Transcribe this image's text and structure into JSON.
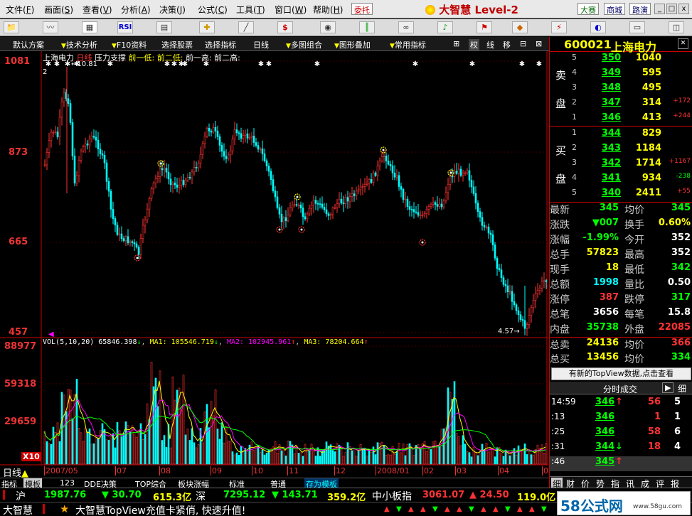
{
  "menu": {
    "items": [
      "文件",
      "画面",
      "查看",
      "分析",
      "决策",
      "公式",
      "工具",
      "窗口",
      "帮助"
    ],
    "entrust": "委托",
    "brand": "大智慧 Level-2",
    "btn_contest": "大赛",
    "btn_mall": "商城",
    "btn_roadshow": "路演",
    "win_min": "_",
    "win_max": "□",
    "win_close": "x"
  },
  "funcbar": {
    "items": [
      "默认方案",
      "技术分析",
      "F10资料",
      "选择股票",
      "选择指标",
      "日线",
      "多图组合",
      "图形叠加",
      "常用指标"
    ],
    "right_items": [
      "⊞",
      "权",
      "线",
      "移",
      "⊟",
      "⊠"
    ]
  },
  "chart": {
    "stock_label": "上海电力",
    "period_label": "日线",
    "indicator_label": "压力支撑",
    "support_labels": [
      "前一低:",
      "前二低:",
      "前一高:",
      "前二高:"
    ],
    "y_ticks": [
      "1081",
      "873",
      "665",
      "457"
    ],
    "high_marker": "10.81",
    "low_marker": "4.57",
    "label_2": "2",
    "vol_label": "VOL(5,10,20)",
    "vol_value": "65846.398",
    "ma1_label": "MA1: 105546.719",
    "ma2_label": "MA2: 102945.961",
    "ma3_label": "MA3: 78204.664",
    "vol_ticks": [
      "88977",
      "59318",
      "29659",
      "X10"
    ],
    "x_labels": [
      "2007/05",
      "07",
      "08",
      "09",
      "10",
      "11",
      "12",
      "2008/01",
      "02",
      "03",
      "04",
      "05"
    ],
    "period_tag": "日线"
  },
  "tabs": [
    "指标",
    "模板",
    "123",
    "DDE决策",
    "TOP综合",
    "板块涨幅",
    "标准",
    "普通",
    "存为模板"
  ],
  "right_panel": {
    "code": "600021",
    "name": "上海电力",
    "sell_label": [
      "卖",
      "盘"
    ],
    "buy_label": [
      "买",
      "盘"
    ],
    "sells": [
      {
        "lv": "5",
        "p": "350",
        "v": "1040",
        "d": ""
      },
      {
        "lv": "4",
        "p": "349",
        "v": "595",
        "d": ""
      },
      {
        "lv": "3",
        "p": "348",
        "v": "495",
        "d": ""
      },
      {
        "lv": "2",
        "p": "347",
        "v": "314",
        "d": "+172"
      },
      {
        "lv": "1",
        "p": "346",
        "v": "413",
        "d": "+244"
      }
    ],
    "buys": [
      {
        "lv": "1",
        "p": "344",
        "v": "829",
        "d": ""
      },
      {
        "lv": "2",
        "p": "343",
        "v": "1184",
        "d": ""
      },
      {
        "lv": "3",
        "p": "342",
        "v": "1714",
        "d": "+1167"
      },
      {
        "lv": "4",
        "p": "341",
        "v": "934",
        "d": "-238"
      },
      {
        "lv": "5",
        "p": "340",
        "v": "2411",
        "d": "+55"
      }
    ],
    "stats": [
      {
        "l1": "最新",
        "v1": "345",
        "c1": "green",
        "l2": "均价",
        "v2": "345",
        "c2": "green"
      },
      {
        "l1": "涨跌",
        "v1": "▼007",
        "c1": "green",
        "l2": "换手",
        "v2": "0.60%",
        "c2": "yellow"
      },
      {
        "l1": "涨幅",
        "v1": "-1.99%",
        "c1": "green",
        "l2": "今开",
        "v2": "352",
        "c2": "white"
      },
      {
        "l1": "总手",
        "v1": "57823",
        "c1": "yellow",
        "l2": "最高",
        "v2": "352",
        "c2": "white"
      },
      {
        "l1": "现手",
        "v1": "18",
        "c1": "yellow",
        "l2": "最低",
        "v2": "342",
        "c2": "green"
      },
      {
        "l1": "总额",
        "v1": "1998",
        "c1": "cyan",
        "l2": "量比",
        "v2": "0.50",
        "c2": "white"
      },
      {
        "l1": "涨停",
        "v1": "387",
        "c1": "red",
        "l2": "跌停",
        "v2": "317",
        "c2": "green"
      },
      {
        "l1": "总笔",
        "v1": "3656",
        "c1": "white",
        "l2": "每笔",
        "v2": "15.8",
        "c2": "white"
      },
      {
        "l1": "内盘",
        "v1": "35738",
        "c1": "green",
        "l2": "外盘",
        "v2": "22085",
        "c2": "red"
      },
      {
        "l1": "总卖",
        "v1": "24136",
        "c1": "yellow",
        "l2": "均价",
        "v2": "366",
        "c2": "red"
      },
      {
        "l1": "总买",
        "v1": "13456",
        "c1": "yellow",
        "l2": "均价",
        "v2": "334",
        "c2": "green"
      }
    ],
    "topview_btn": "有新的TopView数据,点击查看",
    "tick_header": "分时成交",
    "tick_btn1": "▶",
    "tick_btn2": "细",
    "ticks": [
      {
        "t": "14:59",
        "p": "346",
        "pc": "green",
        "a": "↑",
        "ac": "red",
        "v": "56",
        "n": "5"
      },
      {
        "t": ":13",
        "p": "346",
        "pc": "green",
        "a": "",
        "ac": "red",
        "v": "1",
        "n": "1"
      },
      {
        "t": ":25",
        "p": "346",
        "pc": "green",
        "a": "",
        "ac": "red",
        "v": "58",
        "n": "6"
      },
      {
        "t": ":31",
        "p": "344",
        "pc": "green",
        "a": "↓",
        "ac": "green",
        "v": "18",
        "n": "4"
      },
      {
        "t": ":46",
        "p": "345",
        "pc": "green",
        "a": "↑",
        "ac": "red",
        "v": "",
        "n": ""
      }
    ],
    "bottom_tabs": [
      "细",
      "财",
      "价",
      "势",
      "指",
      "讯",
      "成",
      "评",
      "报"
    ]
  },
  "index_bar": {
    "sh_label": "沪",
    "sh_val": "1987.76",
    "sh_chg": "▼ 30.70",
    "sh_amt": "615.3亿",
    "sz_label": "深",
    "sz_val": "7295.12",
    "sz_chg": "▼ 143.71",
    "sz_amt": "359.2亿",
    "zx_label": "中小板指",
    "zx_val": "3061.07",
    "zx_chg": "▲ 24.50",
    "zx_amt": "119.0亿"
  },
  "status": {
    "brand": "大智慧",
    "star": "★",
    "marquee": "大智慧TopView充值卡紧俏, 快速升值!",
    "watermark": "58公式网",
    "watermark_url": "www.58gu.com"
  },
  "colors": {
    "up": "#ff3333",
    "down": "#00ffff",
    "grid": "#550000",
    "ma1": "#ffffff",
    "ma2": "#ff00ff",
    "ma3": "#00ff00",
    "accent": "#cc0000"
  }
}
